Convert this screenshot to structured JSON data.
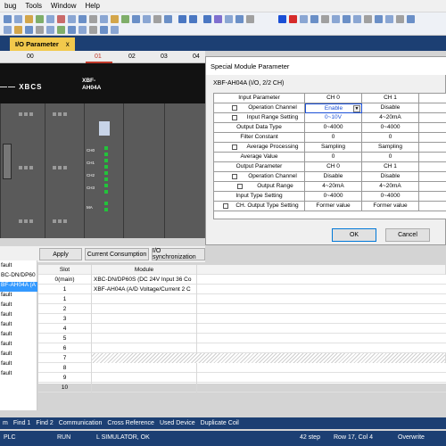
{
  "menu": [
    "bug",
    "Tools",
    "Window",
    "Help"
  ],
  "tab": {
    "label": "I/O Parameter",
    "close": "x"
  },
  "slot_numbers": [
    "00",
    "01",
    "02",
    "03",
    "04"
  ],
  "rack": {
    "logo": "—— XBCS",
    "model_line1": "XBF-",
    "model_line2": "AH04A",
    "terminals": [
      "CH0",
      "CH1",
      "CH2",
      "CH3",
      "MA"
    ]
  },
  "buttons": {
    "apply": "Apply",
    "current": "Current Consumption",
    "io_sync": "I/O synchronization"
  },
  "tree": [
    "fault",
    "BC-DN/DP60",
    "BF-AH04A (A",
    "fault",
    "fault",
    "fault",
    "fault",
    "fault",
    "fault",
    "fault",
    "fault",
    "fault"
  ],
  "slot_table": {
    "headers": [
      "Slot",
      "Module"
    ],
    "rows": [
      {
        "slot": "0(main)",
        "module": "XBC-DN/DP60S (DC 24V Input 36 Co"
      },
      {
        "slot": "1",
        "module": "XBF-AH04A (A/D Voltage/Current 2 C"
      },
      {
        "slot": "1",
        "module": ""
      },
      {
        "slot": "2",
        "module": ""
      },
      {
        "slot": "3",
        "module": ""
      },
      {
        "slot": "4",
        "module": ""
      },
      {
        "slot": "5",
        "module": ""
      },
      {
        "slot": "6",
        "module": ""
      },
      {
        "slot": "7",
        "module": ""
      },
      {
        "slot": "8",
        "module": ""
      },
      {
        "slot": "9",
        "module": ""
      },
      {
        "slot": "10",
        "module": ""
      }
    ]
  },
  "dialog": {
    "title": "Special Module Parameter",
    "subtitle": "XBF-AH04A (I/O, 2/2 CH)",
    "headers": [
      "Input Parameter",
      "CH 0",
      "CH 1"
    ],
    "rows": [
      {
        "label": "Operation Channel",
        "checkbox": true,
        "ch0": "Enable",
        "ch1": "Disable"
      },
      {
        "label": "Input Range Setting",
        "checkbox": true,
        "ch0": "0~10V",
        "ch1": "4~20mA"
      },
      {
        "label": "Output Data Type",
        "checkbox": false,
        "ch0": "0~4000",
        "ch1": "0~4000"
      },
      {
        "label": "Filter Constant",
        "checkbox": false,
        "ch0": "0",
        "ch1": "0"
      },
      {
        "label": "Average Processing",
        "checkbox": true,
        "ch0": "Sampling",
        "ch1": "Sampling"
      },
      {
        "label": "Average Value",
        "checkbox": false,
        "ch0": "0",
        "ch1": "0"
      }
    ],
    "out_headers": [
      "Output Parameter",
      "CH 0",
      "CH 1"
    ],
    "out_rows": [
      {
        "label": "Operation Channel",
        "checkbox": true,
        "ch0": "Disable",
        "ch1": "Disable"
      },
      {
        "label": "Output Range",
        "checkbox": true,
        "ch0": "4~20mA",
        "ch1": "4~20mA"
      },
      {
        "label": "Input Type Setting",
        "checkbox": false,
        "ch0": "0~4000",
        "ch1": "0~4000"
      },
      {
        "label": "CH. Output Type Setting",
        "checkbox": true,
        "ch0": "Former value",
        "ch1": "Former value"
      }
    ],
    "ok": "OK",
    "cancel": "Cancel"
  },
  "bottom_tabs": [
    "m",
    "Find 1",
    "Find 2",
    "Communication",
    "Cross Reference",
    "Used Device",
    "Duplicate Coil"
  ],
  "status": {
    "left": "PLC",
    "run": "RUN",
    "sim": "L SIMULATOR, OK",
    "step": "42 step",
    "pos": "Row 17, Col 4",
    "mode": "Overwrite"
  },
  "colors": {
    "accent": "#1c3f73",
    "tab": "#f2c94c",
    "led": "#22c33a"
  }
}
